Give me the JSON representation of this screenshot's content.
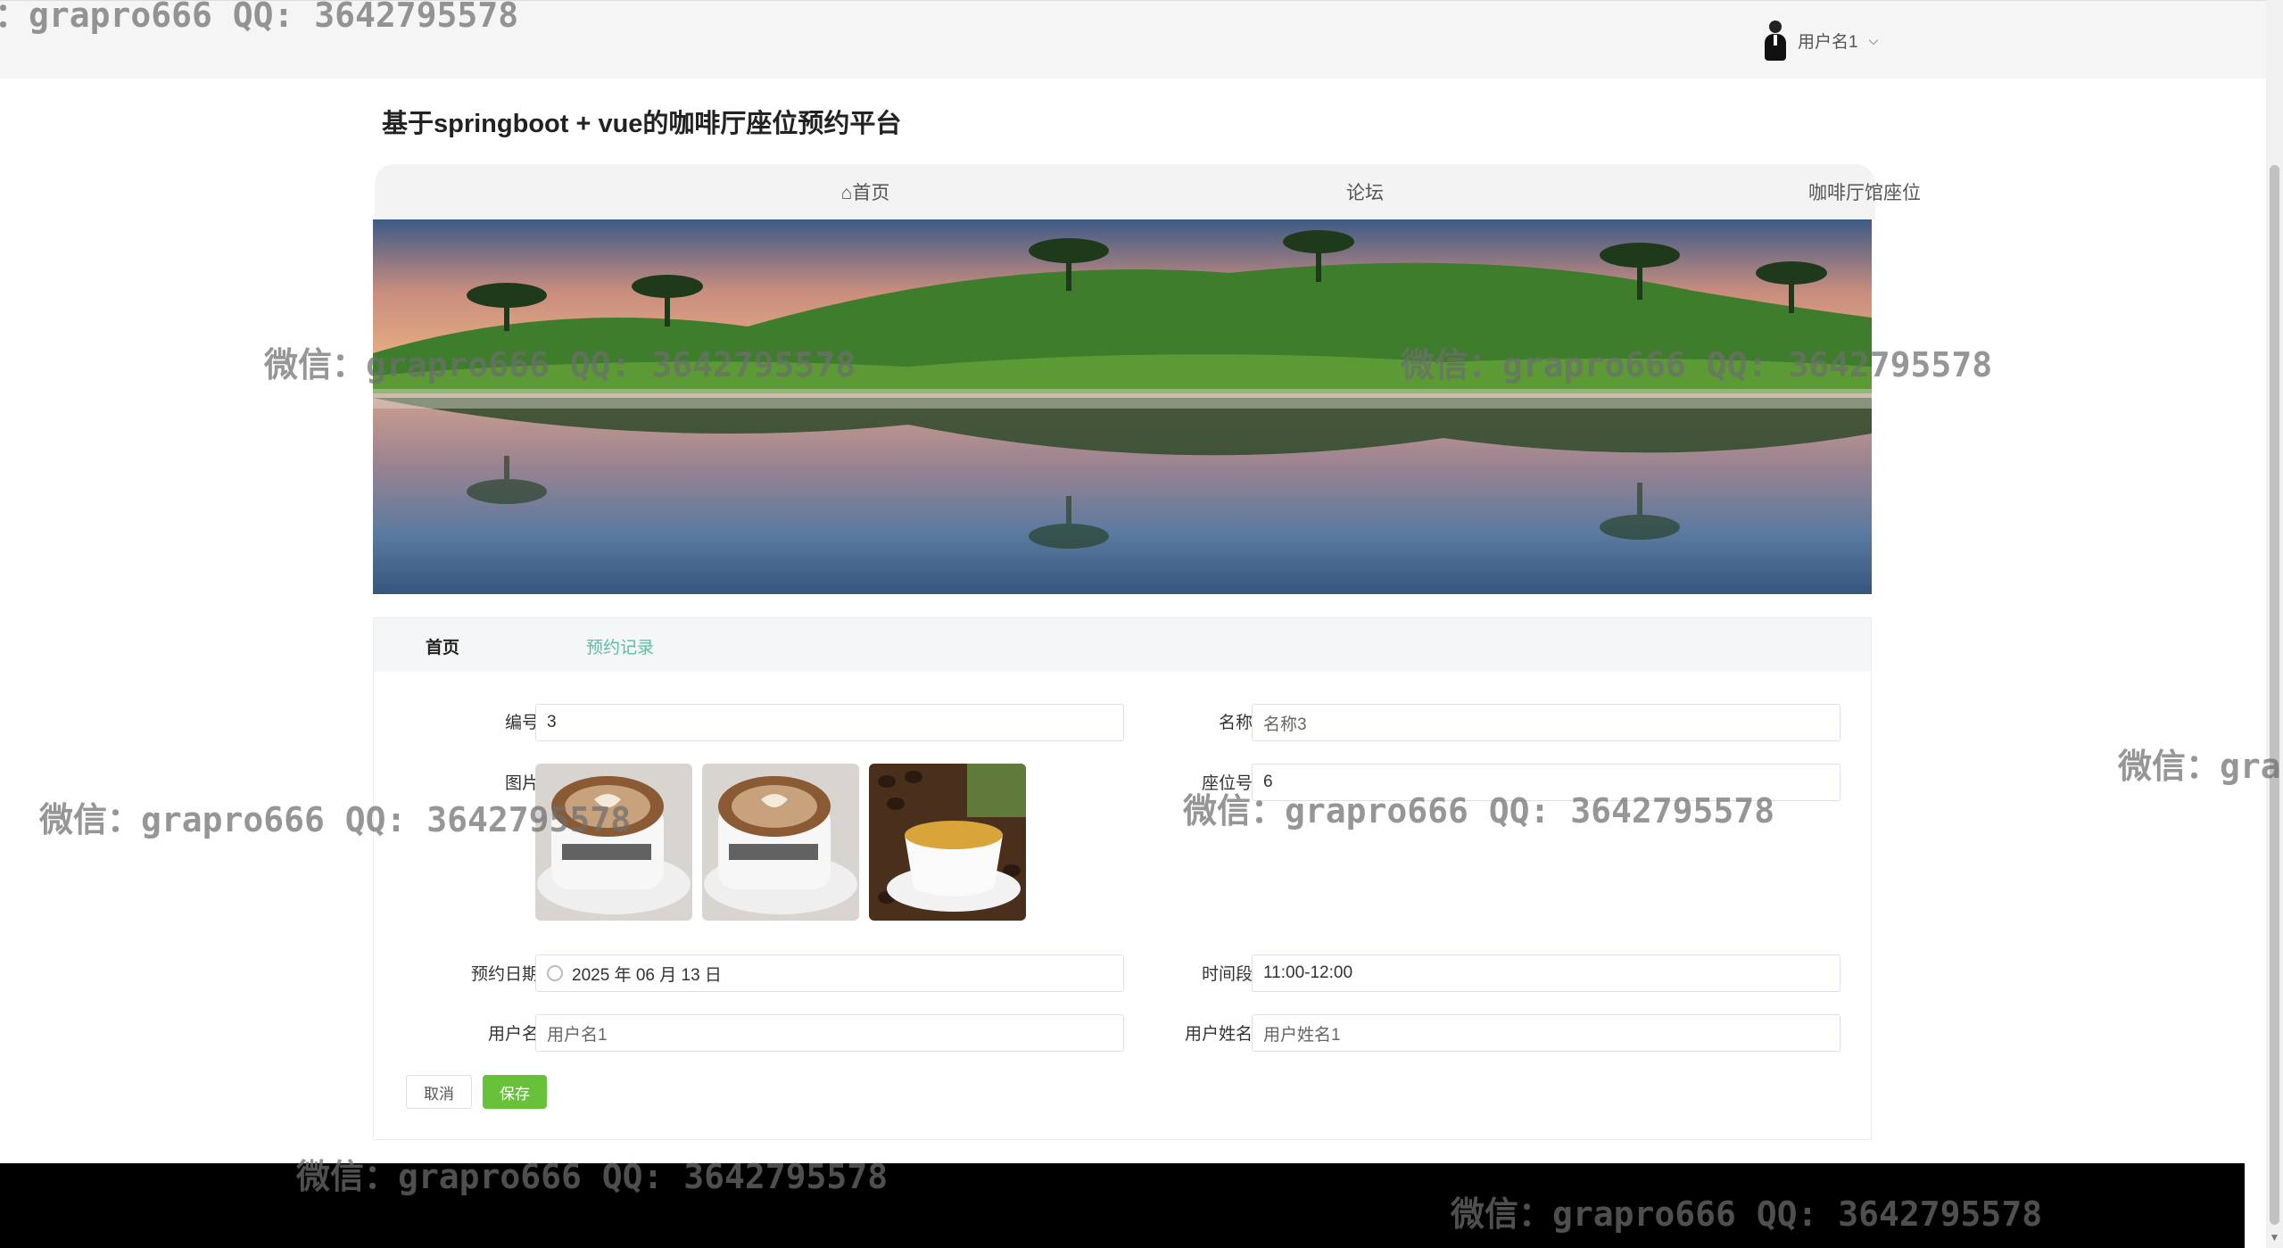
{
  "header": {
    "user_name": "用户名1",
    "caret": "⌵"
  },
  "site": {
    "title": "基于springboot + vue的咖啡厅座位预约平台"
  },
  "nav": {
    "home_icon": "⌂",
    "items": [
      "首页",
      "论坛",
      "咖啡厅馆座位"
    ]
  },
  "tabs": {
    "items": [
      "首页",
      "预约记录"
    ]
  },
  "form": {
    "number_label": "编号",
    "number_value": "3",
    "name_label": "名称",
    "name_value": "名称3",
    "image_label": "图片",
    "seat_label": "座位号",
    "seat_value": "6",
    "date_label": "预约日期",
    "date_value": "2025 年 06 月 13 日",
    "time_label": "时间段",
    "time_value": "11:00-12:00",
    "username_label": "用户名",
    "username_value": "用户名1",
    "fullname_label": "用户姓名",
    "fullname_value": "用户姓名1"
  },
  "buttons": {
    "cancel": "取消",
    "save": "保存"
  },
  "watermarks": [
    "：grapro666 QQ: 3642795578",
    "微信：grapro666 QQ: 3642795578",
    "微信：grapro666 QQ: 3642795578",
    "微信：gra",
    "微信：grapro666 QQ: 3642795578",
    "微信：grapro666 QQ: 3642795578",
    "微信：grapro666 QQ: 3642795578",
    "微信：grapro666 QQ: 3642795578"
  ],
  "colors": {
    "accent_green": "#67c23a",
    "tab_link": "#5bbda2",
    "footer": "#000000"
  }
}
